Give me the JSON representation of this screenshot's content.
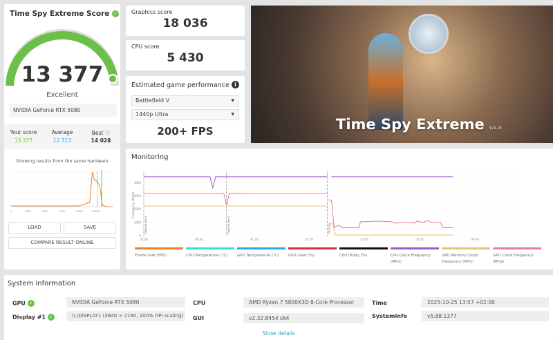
{
  "score_card": {
    "title": "Time Spy Extreme Score",
    "score": "13 377",
    "rating": "Excellent",
    "gpu": "NVIDIA GeForce RTX 5080",
    "your_score_label": "Your score",
    "your_score": "13 377",
    "average_label": "Average",
    "average": "12 713",
    "best_label": "Best",
    "best": "14 028",
    "hist_title": "Showing results from the same hardware",
    "load": "LOAD",
    "save": "SAVE",
    "compare": "COMPARE RESULT ONLINE"
  },
  "histogram": {
    "ticks": [
      "0",
      "2500",
      "5000",
      "7500",
      "10000",
      "12500"
    ],
    "xmax": 15000,
    "points": [
      [
        0,
        0.02
      ],
      [
        10000,
        0.02
      ],
      [
        11000,
        0.08
      ],
      [
        11600,
        0.12
      ],
      [
        12000,
        1.0
      ],
      [
        12300,
        0.78
      ],
      [
        12700,
        0.72
      ],
      [
        13100,
        0.6
      ],
      [
        13450,
        0.05
      ],
      [
        14000,
        0
      ],
      [
        15000,
        0
      ]
    ],
    "average": 12713,
    "your_score": 13377
  },
  "graphics": {
    "label": "Graphics score",
    "value": "18 036"
  },
  "cpu": {
    "label": "CPU score",
    "value": "5 430"
  },
  "estimate": {
    "title": "Estimated game performance",
    "game": "Battlefield V",
    "preset": "1440p Ultra",
    "fps": "200+ FPS"
  },
  "hero": {
    "title": "Time Spy Extreme",
    "version": "(v1.2)"
  },
  "monitoring": {
    "title": "Monitoring",
    "chart_data": {
      "type": "line",
      "ylabel": "Frequency (MHz)",
      "ylim": [
        0,
        4600
      ],
      "xlim": [
        0,
        240
      ],
      "yticks": [
        "0",
        "1000",
        "2000",
        "3000",
        "4000"
      ],
      "xticks": [
        "00:00",
        "00:40",
        "01:20",
        "02:00",
        "02:40",
        "03:20",
        "04:00"
      ],
      "markers": [
        {
          "label": "Graphics test 1",
          "t": 0
        },
        {
          "label": "Graphics test 2",
          "t": 60
        },
        {
          "label": "CPU test",
          "t": 133
        }
      ],
      "series": [
        {
          "name": "CPU Clock Frequency (MHz)",
          "color": "#9b59d0",
          "points": [
            [
              0,
              4450
            ],
            [
              48,
              4450
            ],
            [
              50,
              3600
            ],
            [
              52,
              4450
            ],
            [
              133,
              4450
            ],
            null,
            [
              136,
              4450
            ],
            [
              224,
              4450
            ]
          ]
        },
        {
          "name": "GPU Memory Clock Frequency (MHz)",
          "color": "#e8c36a",
          "points": [
            [
              0,
              2250
            ],
            [
              133,
              2250
            ],
            null,
            [
              134,
              900
            ],
            [
              137,
              900
            ],
            [
              139,
              50
            ],
            [
              224,
              50
            ]
          ]
        },
        {
          "name": "GPU Clock Frequency (MHz)",
          "color": "#e87aa8",
          "points": [
            [
              0,
              3200
            ],
            [
              58,
              3200
            ],
            [
              60,
              2300
            ],
            [
              62,
              3200
            ],
            [
              100,
              3180
            ],
            [
              132,
              3200
            ],
            [
              133,
              3250
            ],
            null,
            [
              134,
              2700
            ],
            [
              136,
              2700
            ],
            [
              138,
              600
            ],
            [
              140,
              750
            ],
            [
              142,
              750
            ],
            [
              144,
              600
            ],
            [
              156,
              600
            ],
            [
              157,
              1050
            ],
            [
              170,
              1100
            ],
            [
              180,
              1050
            ],
            [
              182,
              950
            ],
            [
              190,
              1000
            ],
            [
              196,
              950
            ],
            [
              198,
              1100
            ],
            [
              202,
              1000
            ],
            [
              206,
              1150
            ],
            [
              208,
              1000
            ],
            [
              215,
              1000
            ],
            [
              217,
              600
            ],
            [
              224,
              600
            ]
          ]
        }
      ]
    },
    "legend": [
      {
        "label": "Frame rate (FPS)",
        "color": "#f07f28"
      },
      {
        "label": "CPU Temperature (°C)",
        "color": "#3de0c0"
      },
      {
        "label": "GPU Temperature (°C)",
        "color": "#2aa8e8"
      },
      {
        "label": "GPU Load (%)",
        "color": "#d83030"
      },
      {
        "label": "CPU Utility (%)",
        "color": "#111111"
      },
      {
        "label": "CPU Clock Frequency (MHz)",
        "color": "#9b59d0"
      },
      {
        "label": "GPU Memory Clock Frequency (MHz)",
        "color": "#e8c36a"
      },
      {
        "label": "GPU Clock Frequency (MHz)",
        "color": "#e87aa8"
      }
    ]
  },
  "sysinfo": {
    "title": "System information",
    "gpu_label": "GPU",
    "gpu": "NVIDIA GeForce RTX 5080",
    "display_label": "Display #1",
    "display": "\\\\.\\DISPLAY1 (3840 × 2160, 200% DPI scaling)",
    "cpu_label": "CPU",
    "cpu": "AMD Ryzen 7 5800X3D 8-Core Processor",
    "gui_label": "GUI",
    "gui": "v2.32.8454 s64",
    "time_label": "Time",
    "time": "2025-10-25 13:57 +02:00",
    "sysinfo_label": "SystemInfo",
    "sysinfo": "v5.88.1377",
    "show_details": "Show details"
  }
}
